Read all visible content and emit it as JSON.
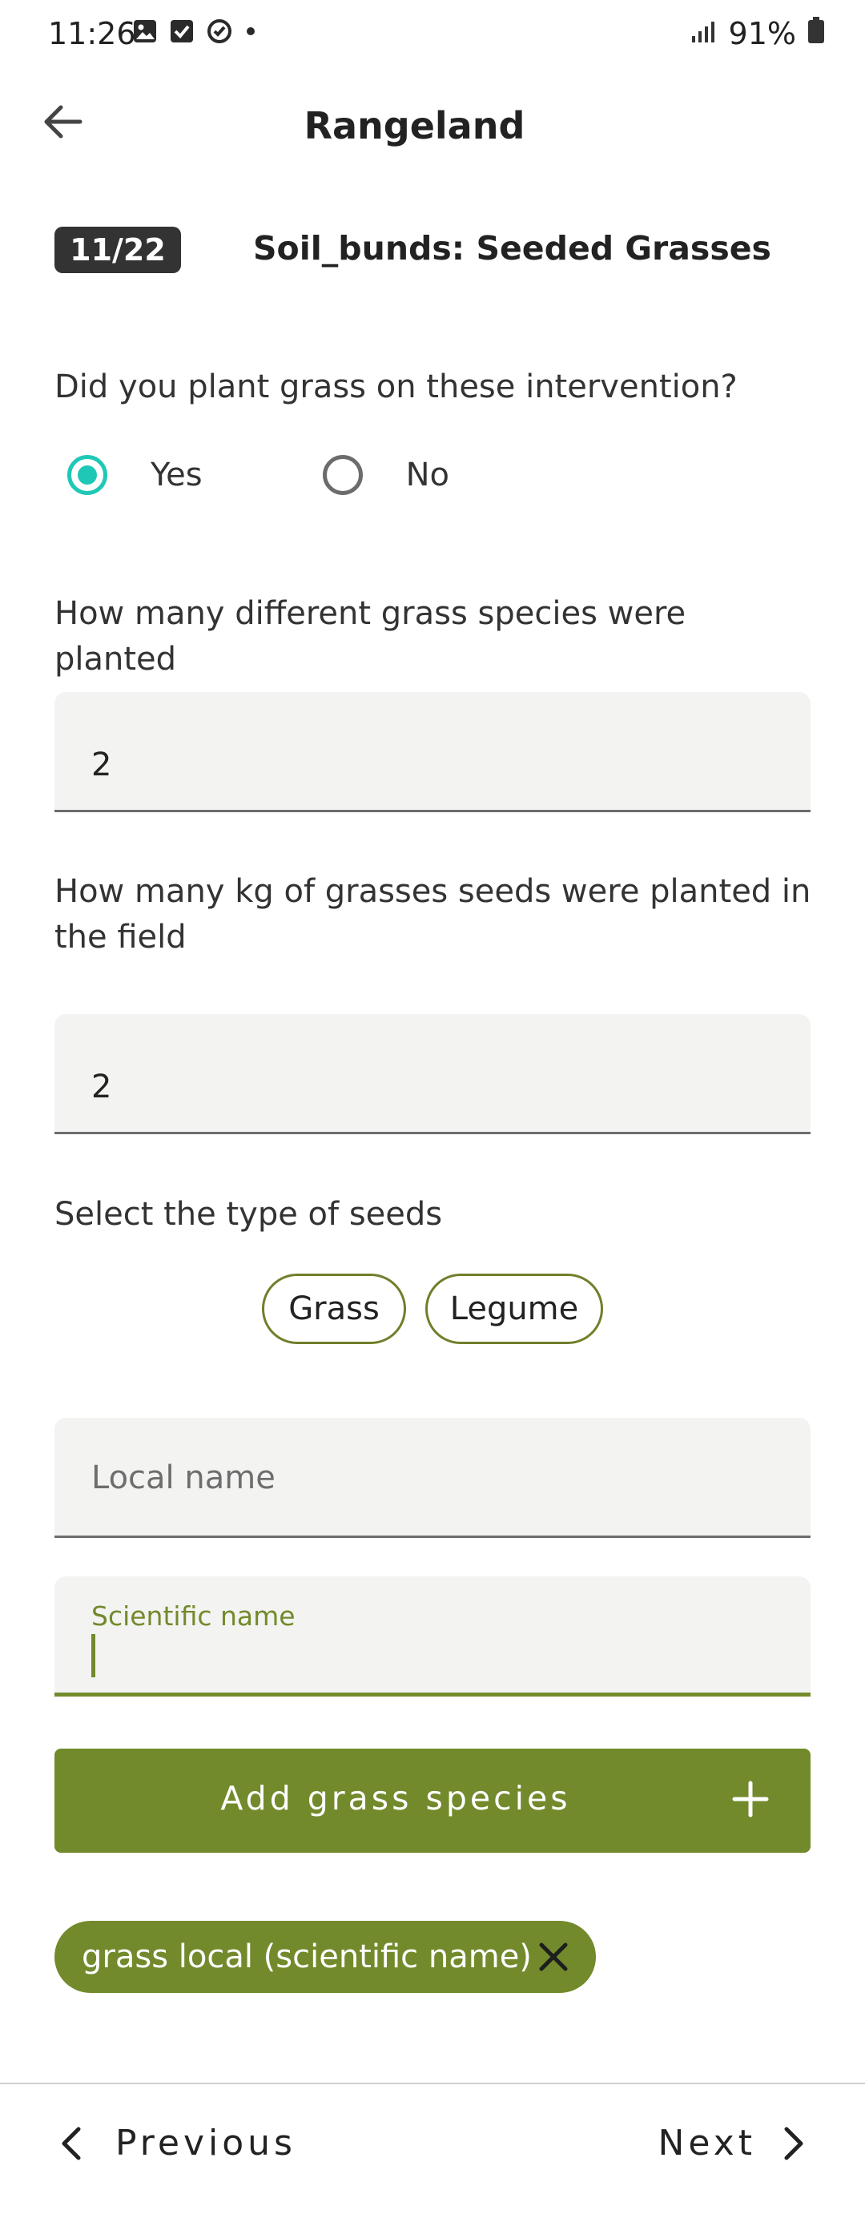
{
  "status_bar": {
    "time": "11:26",
    "battery": "91%"
  },
  "header": {
    "title": "Rangeland"
  },
  "step": {
    "badge": "11/22",
    "title": "Soil_bunds: Seeded Grasses"
  },
  "q_planted": {
    "text": "Did you plant grass on these intervention?",
    "options": [
      {
        "label": "Yes",
        "checked": true
      },
      {
        "label": "No",
        "checked": false
      }
    ]
  },
  "q_species_count": {
    "text": "How many different grass species were planted",
    "value": "2"
  },
  "q_seed_kg": {
    "text": "How many kg of grasses seeds were planted in the field",
    "value": "2"
  },
  "q_seed_type": {
    "text": "Select the type of seeds",
    "chips": [
      "Grass",
      "Legume"
    ]
  },
  "local_name": {
    "placeholder": "Local name"
  },
  "scientific_name": {
    "label": "Scientific name",
    "value": ""
  },
  "add_button": {
    "label": "Add grass species"
  },
  "added_species": [
    {
      "label": "grass local (scientific name)"
    }
  ],
  "footer": {
    "previous": "Previous",
    "next": "Next"
  },
  "colors": {
    "accent_green": "#728a2b",
    "radio_teal": "#1fc8b6",
    "badge_dark": "#333333"
  }
}
